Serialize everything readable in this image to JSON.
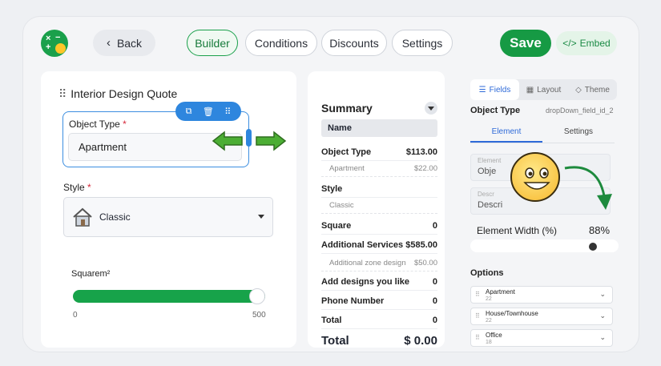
{
  "header": {
    "back_label": "Back",
    "tabs": [
      {
        "label": "Builder"
      },
      {
        "label": "Conditions"
      },
      {
        "label": "Discounts"
      },
      {
        "label": "Settings"
      }
    ],
    "save_label": "Save",
    "embed_label": "Embed",
    "embed_icon": "</>"
  },
  "form": {
    "title": "Interior Design Quote",
    "object_type_label": "Object Type",
    "required_mark": "*",
    "object_type_value": "Apartment",
    "style_label": "Style",
    "style_value": "Classic",
    "square_label": "Squarem²",
    "slider_min": "0",
    "slider_max": "500",
    "slider_fill": 1.0
  },
  "summary": {
    "title": "Summary",
    "name_label": "Name",
    "rows": [
      {
        "label": "Object Type",
        "value": "$113.00"
      },
      {
        "label": "Apartment",
        "value": "$22.00"
      },
      {
        "label": "Style",
        "value": ""
      },
      {
        "label": "Classic",
        "value": ""
      },
      {
        "label": "Square",
        "value": "0"
      },
      {
        "label": "Additional Services",
        "value": "$585.00"
      },
      {
        "label": "Additional zone design",
        "value": "$50.00"
      },
      {
        "label": "Add designs you like",
        "value": "0"
      },
      {
        "label": "Phone Number",
        "value": "0"
      },
      {
        "label": "Total",
        "value": "0"
      }
    ],
    "grand_total_label": "Total",
    "grand_total_value": "$ 0.00"
  },
  "panel": {
    "tabs": [
      {
        "label": "Fields",
        "icon": "fields-icon"
      },
      {
        "label": "Layout",
        "icon": "layout-icon"
      },
      {
        "label": "Theme",
        "icon": "theme-icon"
      }
    ],
    "object_type_label": "Object Type",
    "field_id": "dropDown_field_id_2",
    "subtabs": [
      "Element",
      "Settings"
    ],
    "element_small": "Element",
    "element_value": "Obje",
    "desc_small": "Descr",
    "desc_value": "Descri",
    "width_label": "Element Width (%)",
    "width_value": "88%",
    "width_fraction": 0.88,
    "options_label": "Options",
    "options": [
      {
        "name": "Apartment",
        "value": "22"
      },
      {
        "name": "House/Townhouse",
        "value": "22"
      },
      {
        "name": "Office",
        "value": "18"
      }
    ]
  },
  "colors": {
    "brand_green": "#169a44",
    "accent_blue": "#2e86de"
  }
}
